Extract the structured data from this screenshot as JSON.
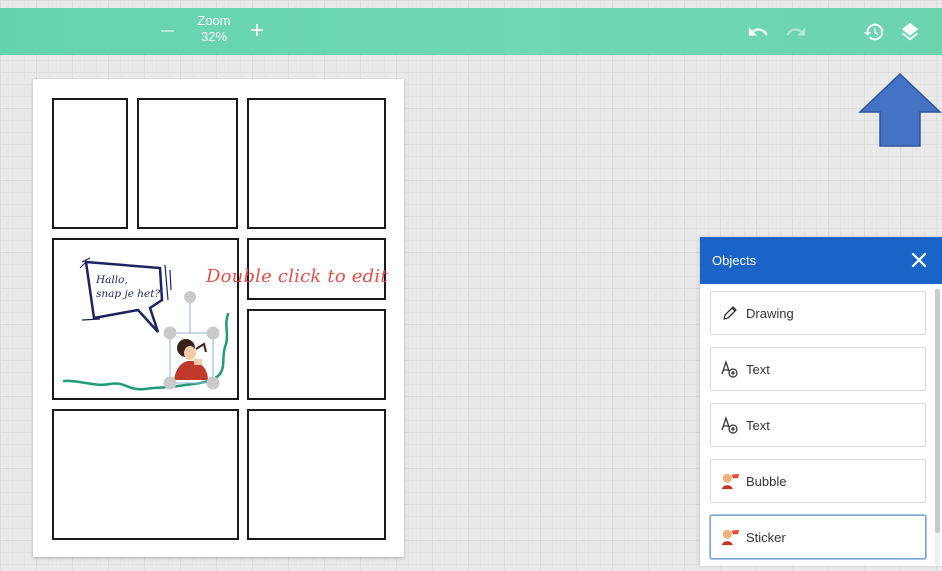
{
  "toolbar": {
    "zoom_label": "Zoom",
    "zoom_value": "32%",
    "zoom_minus_icon": "minus-icon",
    "zoom_plus_symbol": "+",
    "undo_icon": "undo-icon",
    "redo_icon": "redo-icon",
    "history_icon": "history-icon",
    "layers_icon": "layers-icon",
    "accent_color": "#6bd4af"
  },
  "canvas": {
    "edit_hint": "Double click to edit",
    "speech_bubble_text": [
      "Hallo,",
      "snap je het?"
    ]
  },
  "objects_panel": {
    "title": "Objects",
    "close_icon": "close-icon",
    "header_color": "#1a64c7",
    "items": [
      {
        "label": "Drawing",
        "icon": "pencil-icon",
        "selected": false
      },
      {
        "label": "Text",
        "icon": "text-add-icon",
        "selected": false
      },
      {
        "label": "Text",
        "icon": "text-add-icon",
        "selected": false
      },
      {
        "label": "Bubble",
        "icon": "character-thumbnail",
        "selected": false
      },
      {
        "label": "Sticker",
        "icon": "character-thumbnail",
        "selected": true
      }
    ]
  },
  "callout_arrow": {
    "icon": "up-arrow-annotation",
    "color": "#4472c4"
  }
}
